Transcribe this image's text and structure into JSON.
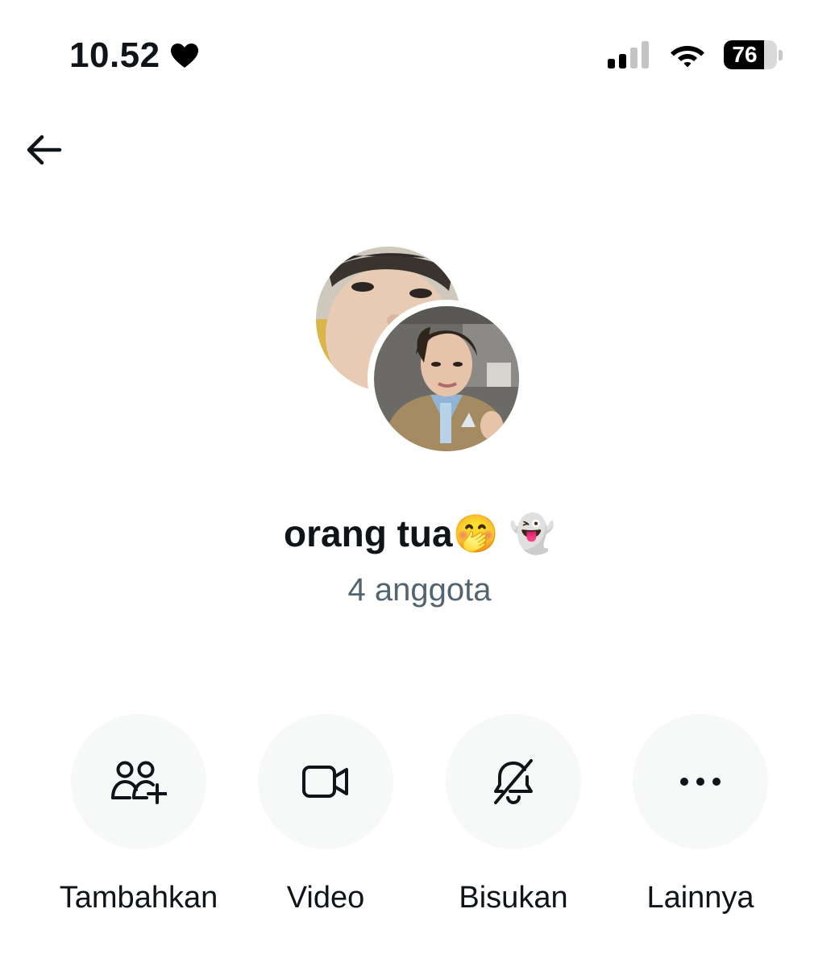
{
  "status_bar": {
    "time": "10.52",
    "battery_level": "76",
    "battery_fraction": 0.76,
    "icons": [
      "heart-icon",
      "signal-icon",
      "wifi-icon",
      "battery-icon"
    ]
  },
  "header": {
    "back_icon": "arrow-left-icon"
  },
  "group": {
    "name": "orang tua🤭 👻",
    "member_count": "4 anggota"
  },
  "actions": [
    {
      "label": "Tambahkan",
      "icon": "add-people-icon"
    },
    {
      "label": "Video",
      "icon": "video-camera-icon"
    },
    {
      "label": "Bisukan",
      "icon": "bell-off-icon"
    },
    {
      "label": "Lainnya",
      "icon": "more-dots-icon"
    }
  ],
  "colors": {
    "text_primary": "#0f1419",
    "text_secondary": "#536471",
    "button_bg": "#f7f9f9"
  }
}
